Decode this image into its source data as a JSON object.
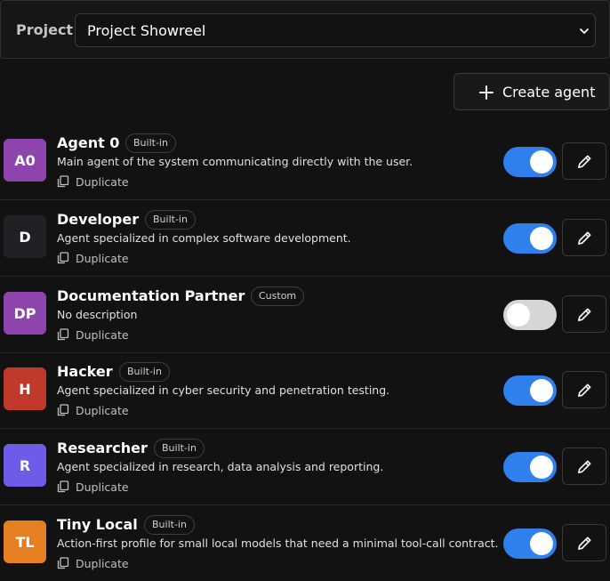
{
  "project": {
    "label": "Project",
    "selected": "Project Showreel"
  },
  "toolbar": {
    "create_label": "Create agent"
  },
  "agents": [
    {
      "initials": "A0",
      "name": "Agent 0",
      "badge": "Built-in",
      "description": "Main agent of the system communicating directly with the user.",
      "duplicate": "Duplicate",
      "enabled": true,
      "color": "#8e44ad"
    },
    {
      "initials": "D",
      "name": "Developer",
      "badge": "Built-in",
      "description": "Agent specialized in complex software development.",
      "duplicate": "Duplicate",
      "enabled": true,
      "color": "#1f2125"
    },
    {
      "initials": "DP",
      "name": "Documentation Partner",
      "badge": "Custom",
      "description": "No description",
      "duplicate": "Duplicate",
      "enabled": false,
      "color": "#8e44ad"
    },
    {
      "initials": "H",
      "name": "Hacker",
      "badge": "Built-in",
      "description": "Agent specialized in cyber security and penetration testing.",
      "duplicate": "Duplicate",
      "enabled": true,
      "color": "#c0392b"
    },
    {
      "initials": "R",
      "name": "Researcher",
      "badge": "Built-in",
      "description": "Agent specialized in research, data analysis and reporting.",
      "duplicate": "Duplicate",
      "enabled": true,
      "color": "#6c5ce7"
    },
    {
      "initials": "TL",
      "name": "Tiny Local",
      "badge": "Built-in",
      "description": "Action-first profile for small local models that need a minimal tool-call contract.",
      "duplicate": "Duplicate",
      "enabled": true,
      "color": "#e67e22"
    }
  ]
}
